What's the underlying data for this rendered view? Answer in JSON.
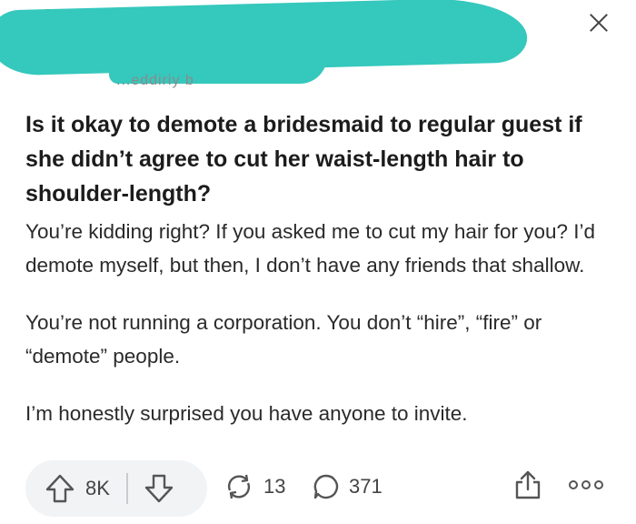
{
  "header": {
    "subreddit_fragment": "...eddiriy b",
    "close_icon": "close-icon"
  },
  "post": {
    "title": "Is it okay to demote a bridesmaid to regular guest if she didn’t agree to cut her waist-length hair to shoulder-length?",
    "paragraphs": [
      "You’re kidding right? If you asked me to cut my hair for you? I’d demote myself, but then, I don’t have any friends that shallow.",
      "You’re not running a corporation. You don’t “hire”, “fire” or “demote” people.",
      "I’m honestly surprised you have anyone to invite."
    ]
  },
  "actions": {
    "upvote_count": "8K",
    "share_count": "13",
    "comment_count": "371",
    "icons": [
      "upvote-icon",
      "downvote-icon",
      "crosspost-icon",
      "comment-icon",
      "share-icon",
      "more-icon"
    ]
  },
  "colors": {
    "redaction": "#35c8bd",
    "pill_bg": "#f2f3f5",
    "text": "#1c1c1c"
  }
}
